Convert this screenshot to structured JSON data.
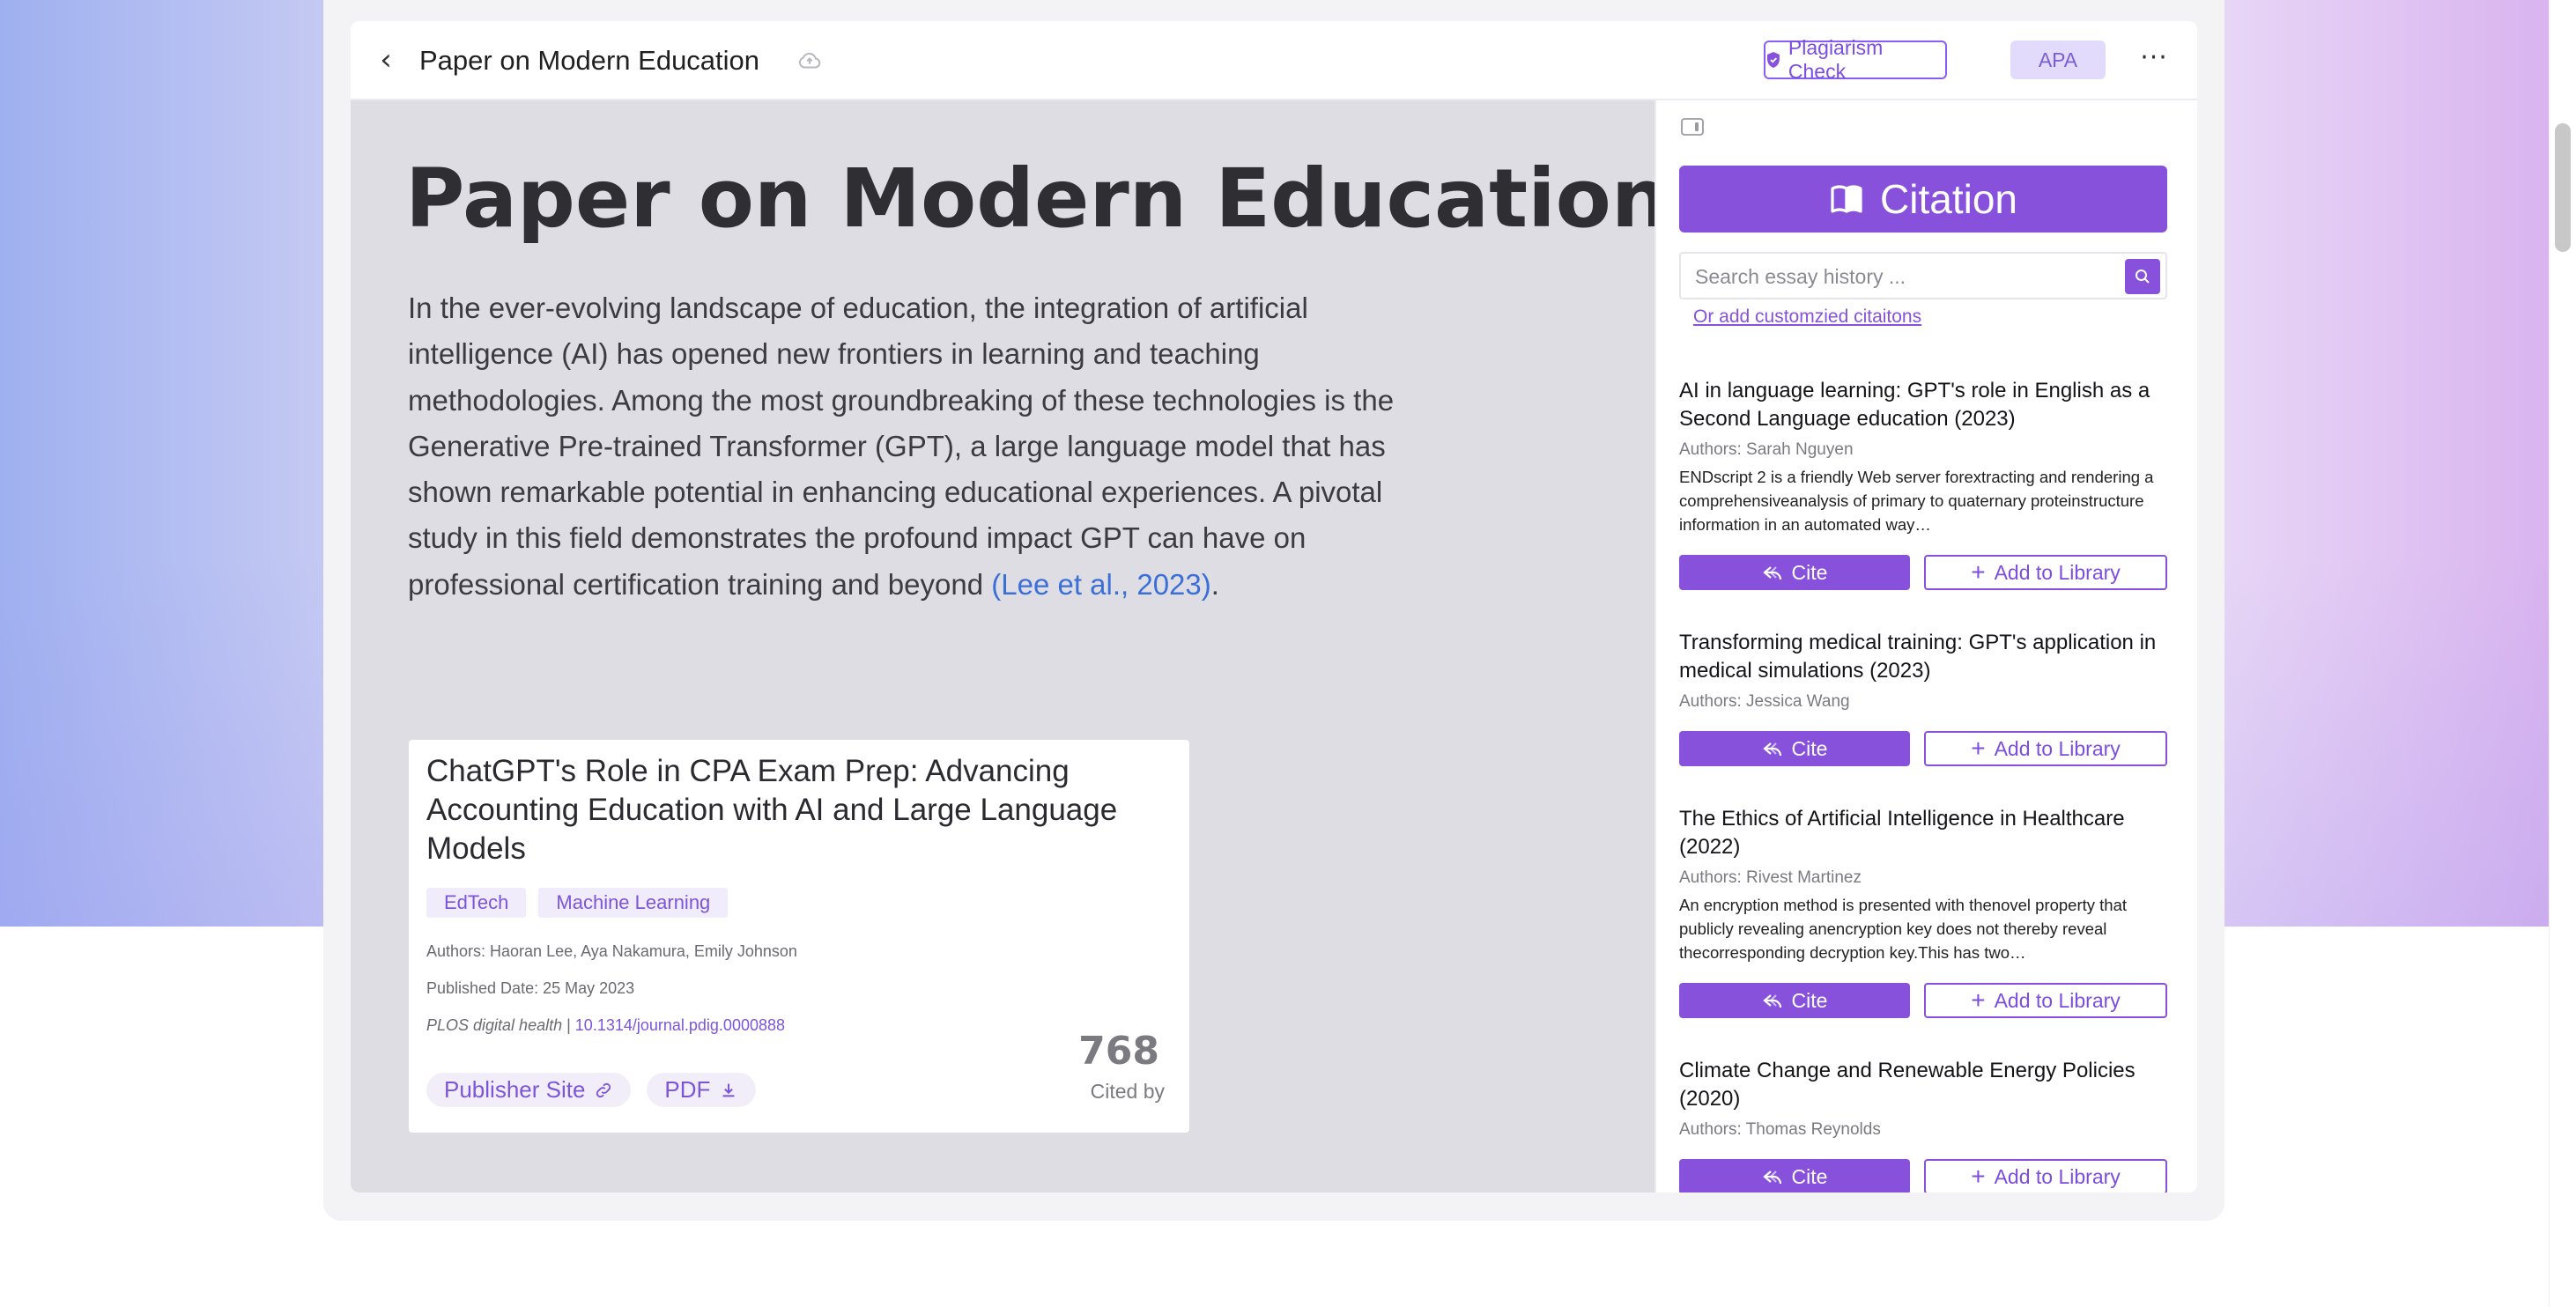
{
  "header": {
    "doc_title": "Paper on Modern Education",
    "plagiarism_label": "Plagiarism Check",
    "style_label": "APA",
    "icons": [
      "chevron-left-icon",
      "cloud-icon",
      "shield-icon",
      "more-icon"
    ]
  },
  "editor": {
    "heading": "Paper on Modern Education",
    "paragraph_text": "In the ever-evolving landscape of education, the integration of artificial intelligence (AI) has opened new frontiers in learning and teaching methodologies. Among the most groundbreaking of these technologies is the Generative Pre-trained Transformer (GPT), a large language model that has shown remarkable potential in enhancing educational experiences. A pivotal study in this field demonstrates the profound impact GPT can have on professional certification training and beyond ",
    "paragraph_citation": "(Lee et al., 2023)",
    "paragraph_end": "."
  },
  "paper_card": {
    "title": "ChatGPT's Role in CPA Exam Prep: Advancing Accounting Education with AI and Large Language Models",
    "tags": [
      "EdTech",
      "Machine Learning"
    ],
    "authors": "Authors: Haoran Lee, Aya Nakamura, Emily Johnson",
    "published": "Published Date: 25 May 2023",
    "journal": "PLOS digital health",
    "separator": " | ",
    "doi": "10.1314/journal.pdig.0000888",
    "publisher_label": "Publisher Site",
    "pdf_label": "PDF",
    "cited_count": "768",
    "cited_label": "Cited by"
  },
  "panel": {
    "citation_label": "Citation",
    "search_placeholder": "Search essay history ...",
    "custom_link": "Or add customzied citaitons",
    "cite_label": "Cite",
    "library_label": "Add to Library",
    "items": [
      {
        "title": "AI in language learning: GPT's role in English as a Second Language education (2023)",
        "authors": "Authors: Sarah Nguyen",
        "desc": "ENDscript 2 is a friendly Web server forextracting and rendering a comprehensiveanalysis of primary to quaternary proteinstructure information in an automated way…"
      },
      {
        "title": "Transforming medical training: GPT's application in medical simulations (2023)",
        "authors": "Authors: Jessica Wang",
        "desc": ""
      },
      {
        "title": "The Ethics of Artificial Intelligence in Healthcare (2022)",
        "authors": "Authors: Rivest Martinez",
        "desc": "An encryption method is presented with thenovel property that publicly revealing anencryption key does not thereby reveal thecorresponding decryption key.This has two…"
      },
      {
        "title": "Climate Change and Renewable Energy Policies (2020)",
        "authors": "Authors: Thomas Reynolds",
        "desc": ""
      }
    ]
  },
  "colors": {
    "accent": "#8751dc",
    "link": "#3a6fd8"
  }
}
